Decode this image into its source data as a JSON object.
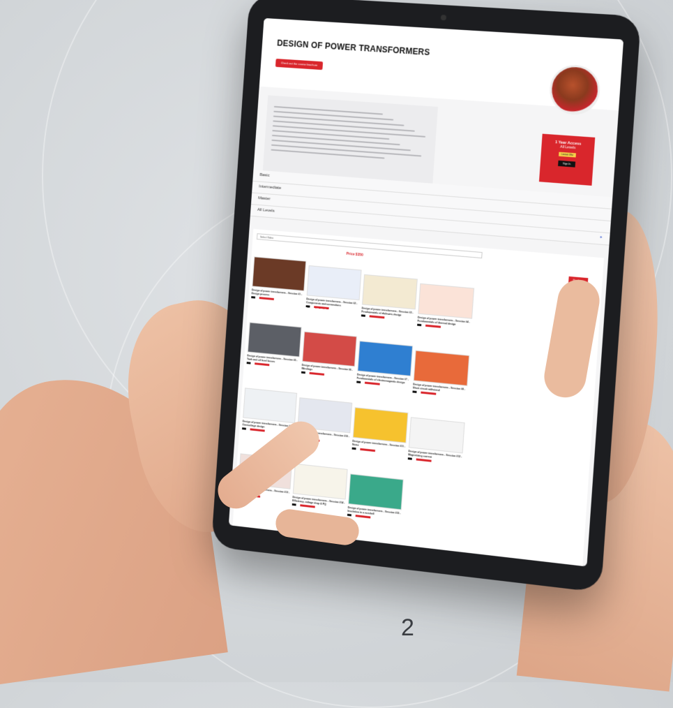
{
  "page": {
    "number": "2"
  },
  "course": {
    "title": "DESIGN OF POWER TRANSFORMERS",
    "check_button": "Check out the course brochure",
    "description_lines": 10
  },
  "access_box": {
    "heading": "1 Year Access",
    "subtext": "All Levels",
    "tag": "Limited Offer",
    "sign_in": "Sign In"
  },
  "levels": [
    "Basic",
    "Intermediate",
    "Master",
    "All Levels"
  ],
  "panel": {
    "select_placeholder": "Select Video",
    "price": "Price $350",
    "purchase": "Purchase"
  },
  "lessons": [
    {
      "title": "Design of power transformers - Session #1 - Design process",
      "thumb": "#6b3a26"
    },
    {
      "title": "Design of power transformers - Session #2 - Components and connections",
      "thumb": "#e9eef8"
    },
    {
      "title": "Design of power transformers - Session #3 - Fundamentals of dielectric design",
      "thumb": "#f3ead2"
    },
    {
      "title": "Design of power transformers - Session #4 - Fundamentals of thermal design",
      "thumb": "#fbe3d8"
    },
    {
      "title": "Design of power transformers - Session #5 - Tank and oil level losses",
      "thumb": "#5c5f66"
    },
    {
      "title": "Design of power transformers - Session #6 - Windings",
      "thumb": "#d34b47"
    },
    {
      "title": "Design of power transformers - Session #7 - Fundamentals of electromagnetic design",
      "thumb": "#2f7fd1"
    },
    {
      "title": "Design of power transformers - Session #8 - Short circuit withstand",
      "thumb": "#e86a3a"
    },
    {
      "title": "Design of power transformers - Session #9 - Overvoltage design",
      "thumb": "#eef1f4"
    },
    {
      "title": "Design of power transformers - Session #10 - Temperature rise",
      "thumb": "#e4e7ef"
    },
    {
      "title": "Design of power transformers - Session #11 - Noise",
      "thumb": "#f6c22e"
    },
    {
      "title": "Design of power transformers - Session #12 - Magnetizing current",
      "thumb": "#f4f4f4"
    },
    {
      "title": "Design of power transformers - Session #13 - Structural design",
      "thumb": "#f0e0dc"
    },
    {
      "title": "Design of power transformers - Session #14 - Efficiency, voltage drop & PQ",
      "thumb": "#f7f4ea"
    },
    {
      "title": "Design of power transformers - Session #15 - Insulation in a nutshell",
      "thumb": "#3aa98a"
    }
  ]
}
